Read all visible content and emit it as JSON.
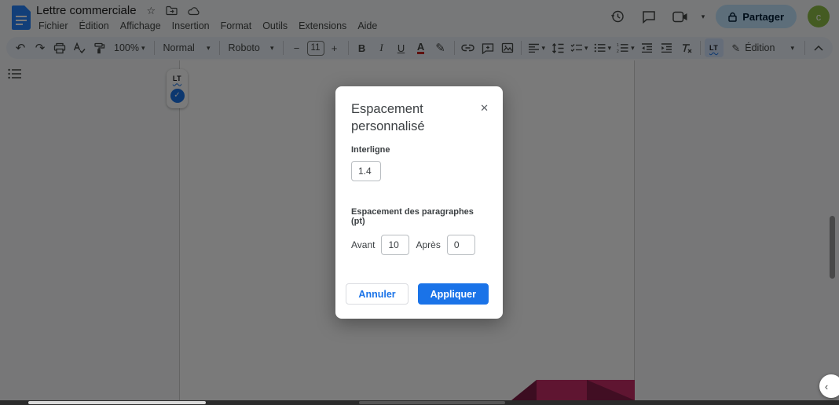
{
  "header": {
    "doc_title": "Lettre commerciale",
    "menus": [
      "Fichier",
      "Édition",
      "Affichage",
      "Insertion",
      "Format",
      "Outils",
      "Extensions",
      "Aide"
    ],
    "share_label": "Partager",
    "avatar_letter": "c"
  },
  "toolbar": {
    "zoom_value": "100%",
    "paragraph_style": "Normal",
    "font_family": "Roboto",
    "font_size": "11",
    "minus": "−",
    "plus": "+",
    "bold": "B",
    "italic": "I",
    "underline": "U",
    "text_color": "A",
    "lt_badge": "LT",
    "mode_label": "Édition"
  },
  "page_badge": {
    "lt_label": "LT"
  },
  "dialog": {
    "title": "Espacement personnalisé",
    "line_spacing_label": "Interligne",
    "line_spacing_value": "1.4",
    "paragraph_spacing_label": "Espacement des paragraphes (pt)",
    "before_label": "Avant",
    "before_value": "10",
    "after_label": "Après",
    "after_value": "0",
    "cancel_label": "Annuler",
    "apply_label": "Appliquer"
  },
  "glyphs": {
    "undo": "↶",
    "redo": "↷",
    "caret_down": "▾",
    "close": "✕",
    "check": "✓",
    "star": "☆",
    "chevron_left": "‹",
    "pencil": "✎",
    "highlighter": "✎"
  },
  "colors": {
    "accent_blue": "#1a73e8",
    "share_bg": "#c2e7ff",
    "share_text": "#001d35",
    "avatar_green": "#8fbf47",
    "active_icon_bg": "#d3e3fd",
    "deco_maroon": "#c62c68",
    "deco_maroon_dark": "#7d1d45",
    "text_color_underline": "#c5221f"
  }
}
